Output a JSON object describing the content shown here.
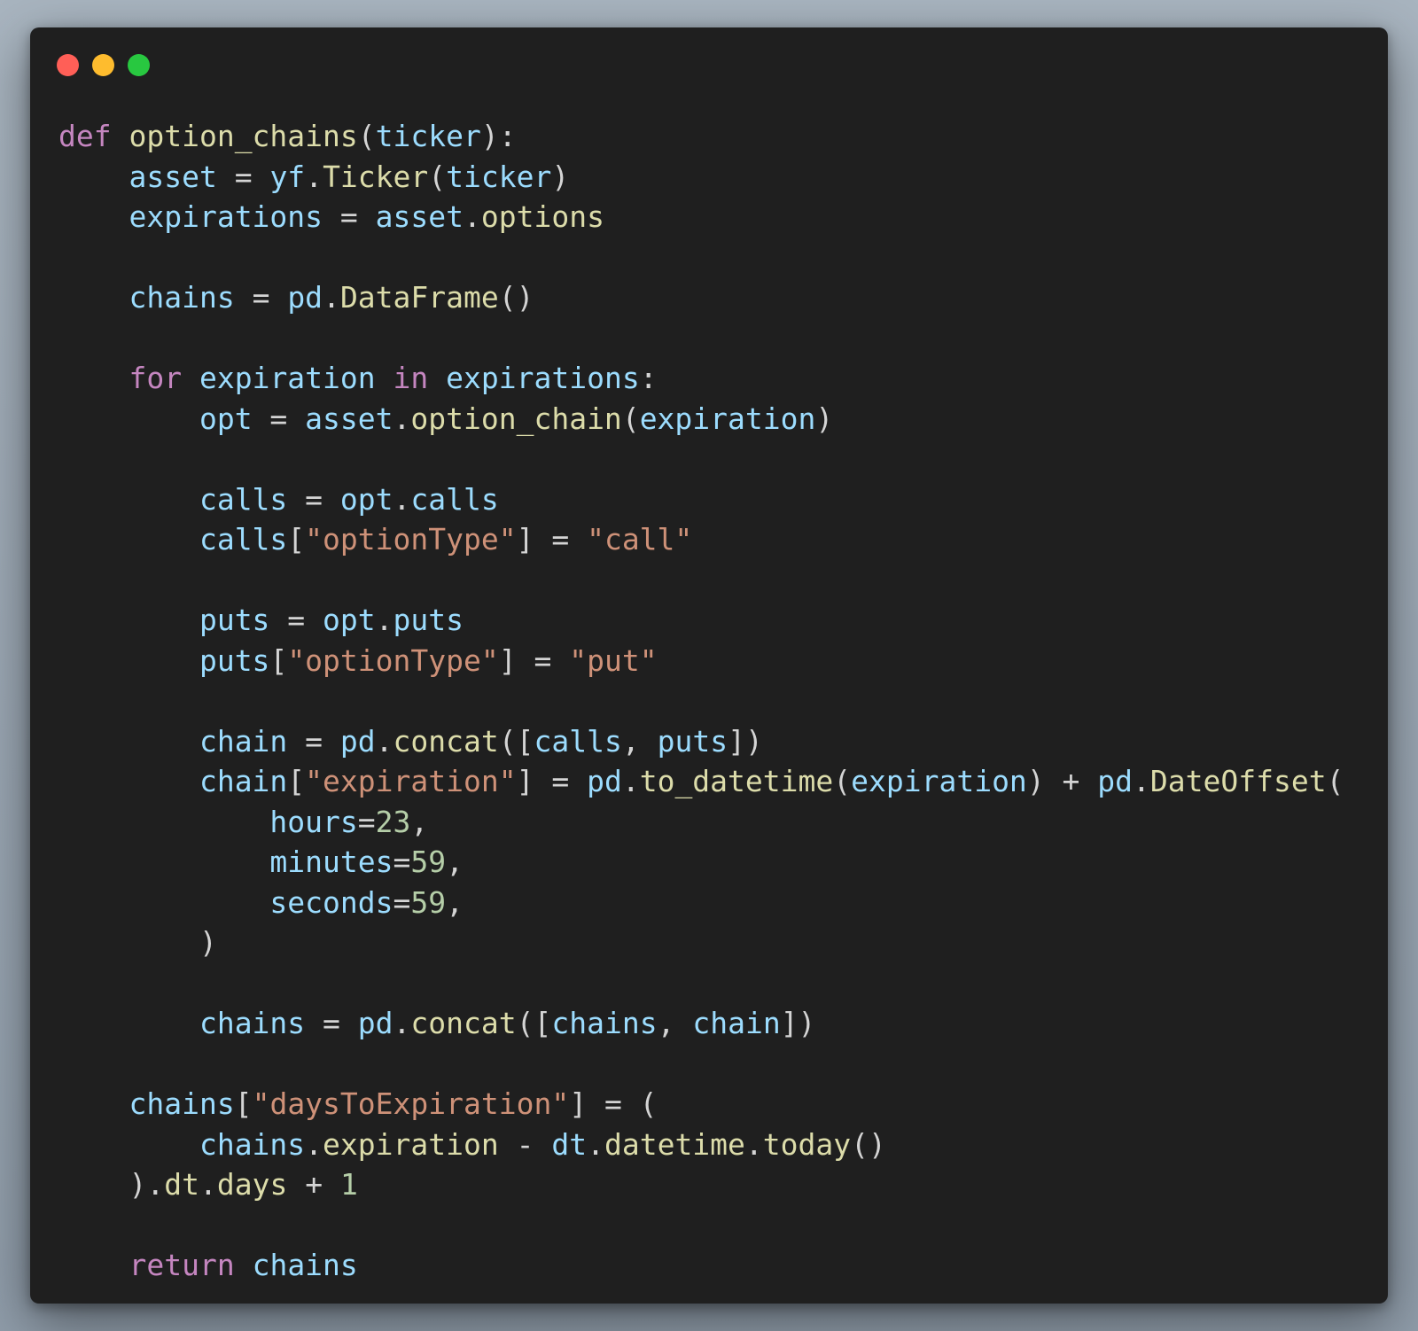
{
  "window": {
    "controls": [
      {
        "name": "close",
        "color": "#ff5f57"
      },
      {
        "name": "minimize",
        "color": "#febc2e"
      },
      {
        "name": "zoom",
        "color": "#28c840"
      }
    ]
  },
  "palette": {
    "background": "#1f1f1f",
    "keyword": "#c586c0",
    "function": "#dcdcaa",
    "variable": "#9cdcfe",
    "string": "#ce9178",
    "number": "#b5cea8",
    "plain": "#d4d4d4"
  },
  "code": {
    "language": "python",
    "lines": [
      [
        [
          "kw",
          "def"
        ],
        [
          "pl",
          " "
        ],
        [
          "fn",
          "option_chains"
        ],
        [
          "pl",
          "("
        ],
        [
          "var",
          "ticker"
        ],
        [
          "pl",
          "):"
        ]
      ],
      [
        [
          "pl",
          "    "
        ],
        [
          "var",
          "asset"
        ],
        [
          "pl",
          " = "
        ],
        [
          "var",
          "yf"
        ],
        [
          "pl",
          "."
        ],
        [
          "fn",
          "Ticker"
        ],
        [
          "pl",
          "("
        ],
        [
          "var",
          "ticker"
        ],
        [
          "pl",
          ")"
        ]
      ],
      [
        [
          "pl",
          "    "
        ],
        [
          "var",
          "expirations"
        ],
        [
          "pl",
          " = "
        ],
        [
          "var",
          "asset"
        ],
        [
          "pl",
          "."
        ],
        [
          "fn",
          "options"
        ]
      ],
      [],
      [
        [
          "pl",
          "    "
        ],
        [
          "var",
          "chains"
        ],
        [
          "pl",
          " = "
        ],
        [
          "var",
          "pd"
        ],
        [
          "pl",
          "."
        ],
        [
          "fn",
          "DataFrame"
        ],
        [
          "pl",
          "()"
        ]
      ],
      [],
      [
        [
          "pl",
          "    "
        ],
        [
          "kw",
          "for"
        ],
        [
          "pl",
          " "
        ],
        [
          "var",
          "expiration"
        ],
        [
          "pl",
          " "
        ],
        [
          "kw",
          "in"
        ],
        [
          "pl",
          " "
        ],
        [
          "var",
          "expirations"
        ],
        [
          "pl",
          ":"
        ]
      ],
      [
        [
          "pl",
          "        "
        ],
        [
          "var",
          "opt"
        ],
        [
          "pl",
          " = "
        ],
        [
          "var",
          "asset"
        ],
        [
          "pl",
          "."
        ],
        [
          "fn",
          "option_chain"
        ],
        [
          "pl",
          "("
        ],
        [
          "var",
          "expiration"
        ],
        [
          "pl",
          ")"
        ]
      ],
      [],
      [
        [
          "pl",
          "        "
        ],
        [
          "var",
          "calls"
        ],
        [
          "pl",
          " = "
        ],
        [
          "var",
          "opt"
        ],
        [
          "pl",
          "."
        ],
        [
          "var",
          "calls"
        ]
      ],
      [
        [
          "pl",
          "        "
        ],
        [
          "var",
          "calls"
        ],
        [
          "pl",
          "["
        ],
        [
          "str",
          "\"optionType\""
        ],
        [
          "pl",
          "] = "
        ],
        [
          "str",
          "\"call\""
        ]
      ],
      [],
      [
        [
          "pl",
          "        "
        ],
        [
          "var",
          "puts"
        ],
        [
          "pl",
          " = "
        ],
        [
          "var",
          "opt"
        ],
        [
          "pl",
          "."
        ],
        [
          "var",
          "puts"
        ]
      ],
      [
        [
          "pl",
          "        "
        ],
        [
          "var",
          "puts"
        ],
        [
          "pl",
          "["
        ],
        [
          "str",
          "\"optionType\""
        ],
        [
          "pl",
          "] = "
        ],
        [
          "str",
          "\"put\""
        ]
      ],
      [],
      [
        [
          "pl",
          "        "
        ],
        [
          "var",
          "chain"
        ],
        [
          "pl",
          " = "
        ],
        [
          "var",
          "pd"
        ],
        [
          "pl",
          "."
        ],
        [
          "fn",
          "concat"
        ],
        [
          "pl",
          "(["
        ],
        [
          "var",
          "calls"
        ],
        [
          "pl",
          ", "
        ],
        [
          "var",
          "puts"
        ],
        [
          "pl",
          "])"
        ]
      ],
      [
        [
          "pl",
          "        "
        ],
        [
          "var",
          "chain"
        ],
        [
          "pl",
          "["
        ],
        [
          "str",
          "\"expiration\""
        ],
        [
          "pl",
          "] = "
        ],
        [
          "var",
          "pd"
        ],
        [
          "pl",
          "."
        ],
        [
          "fn",
          "to_datetime"
        ],
        [
          "pl",
          "("
        ],
        [
          "var",
          "expiration"
        ],
        [
          "pl",
          ") + "
        ],
        [
          "var",
          "pd"
        ],
        [
          "pl",
          "."
        ],
        [
          "fn",
          "DateOffset"
        ],
        [
          "pl",
          "("
        ]
      ],
      [
        [
          "pl",
          "            "
        ],
        [
          "var",
          "hours"
        ],
        [
          "pl",
          "="
        ],
        [
          "num",
          "23"
        ],
        [
          "pl",
          ","
        ]
      ],
      [
        [
          "pl",
          "            "
        ],
        [
          "var",
          "minutes"
        ],
        [
          "pl",
          "="
        ],
        [
          "num",
          "59"
        ],
        [
          "pl",
          ","
        ]
      ],
      [
        [
          "pl",
          "            "
        ],
        [
          "var",
          "seconds"
        ],
        [
          "pl",
          "="
        ],
        [
          "num",
          "59"
        ],
        [
          "pl",
          ","
        ]
      ],
      [
        [
          "pl",
          "        )"
        ]
      ],
      [],
      [
        [
          "pl",
          "        "
        ],
        [
          "var",
          "chains"
        ],
        [
          "pl",
          " = "
        ],
        [
          "var",
          "pd"
        ],
        [
          "pl",
          "."
        ],
        [
          "fn",
          "concat"
        ],
        [
          "pl",
          "(["
        ],
        [
          "var",
          "chains"
        ],
        [
          "pl",
          ", "
        ],
        [
          "var",
          "chain"
        ],
        [
          "pl",
          "])"
        ]
      ],
      [],
      [
        [
          "pl",
          "    "
        ],
        [
          "var",
          "chains"
        ],
        [
          "pl",
          "["
        ],
        [
          "str",
          "\"daysToExpiration\""
        ],
        [
          "pl",
          "] = ("
        ]
      ],
      [
        [
          "pl",
          "        "
        ],
        [
          "var",
          "chains"
        ],
        [
          "pl",
          "."
        ],
        [
          "fn",
          "expiration"
        ],
        [
          "pl",
          " - "
        ],
        [
          "var",
          "dt"
        ],
        [
          "pl",
          "."
        ],
        [
          "fn",
          "datetime"
        ],
        [
          "pl",
          "."
        ],
        [
          "fn",
          "today"
        ],
        [
          "pl",
          "()"
        ]
      ],
      [
        [
          "pl",
          "    )."
        ],
        [
          "fn",
          "dt"
        ],
        [
          "pl",
          "."
        ],
        [
          "fn",
          "days"
        ],
        [
          "pl",
          " + "
        ],
        [
          "num",
          "1"
        ]
      ],
      [],
      [
        [
          "pl",
          "    "
        ],
        [
          "kw",
          "return"
        ],
        [
          "pl",
          " "
        ],
        [
          "var",
          "chains"
        ]
      ]
    ]
  }
}
